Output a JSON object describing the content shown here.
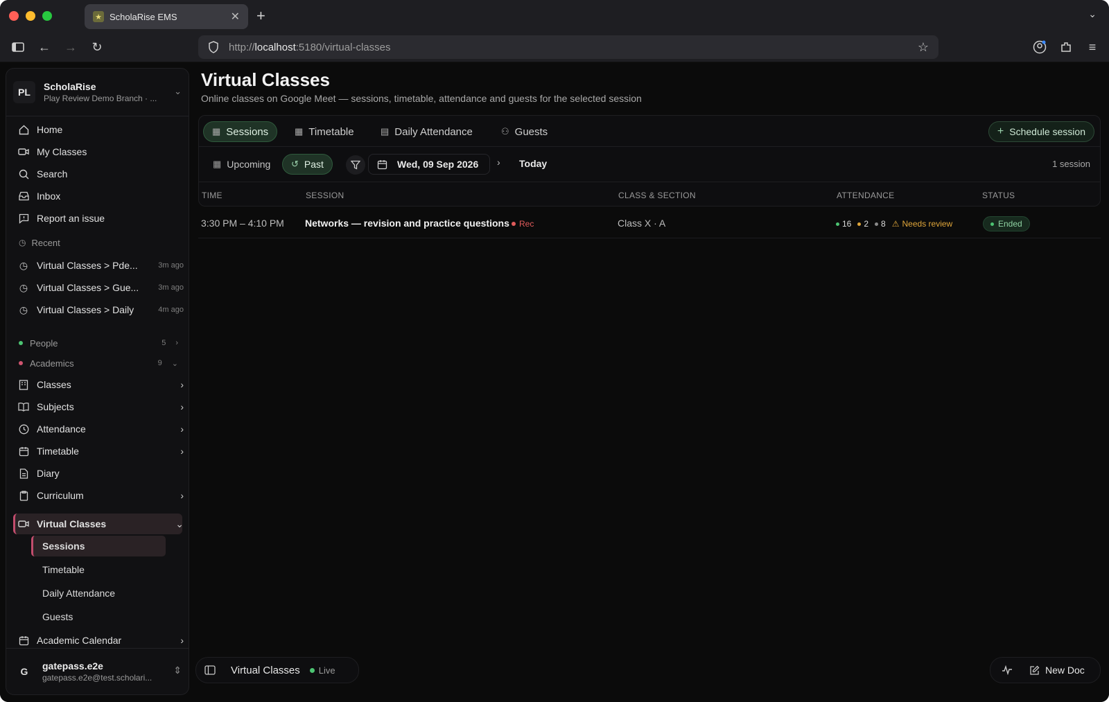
{
  "browser": {
    "tab_title": "ScholaRise EMS",
    "url_prefix": "http://",
    "url_host": "localhost",
    "url_path": ":5180/virtual-classes"
  },
  "workspace": {
    "initials": "PL",
    "name": "ScholaRise",
    "branch": "Play Review Demo Branch · ..."
  },
  "sidebar": {
    "top_items": [
      {
        "label": "Home",
        "icon": "home-icon"
      },
      {
        "label": "My Classes",
        "icon": "video-icon"
      },
      {
        "label": "Search",
        "icon": "search-icon"
      },
      {
        "label": "Inbox",
        "icon": "inbox-icon"
      },
      {
        "label": "Report an issue",
        "icon": "message-icon"
      }
    ],
    "recent_label": "Recent",
    "recent": [
      {
        "label": "Virtual Classes > Pde...",
        "time": "3m ago"
      },
      {
        "label": "Virtual Classes > Gue...",
        "time": "3m ago"
      },
      {
        "label": "Virtual Classes > Daily",
        "time": "4m ago"
      }
    ],
    "groups": [
      {
        "label": "People",
        "count": "5",
        "color": "#4cc472"
      },
      {
        "label": "Academics",
        "count": "9",
        "color": "#d0546f"
      }
    ],
    "academic_items": [
      {
        "label": "Classes",
        "icon": "building-icon"
      },
      {
        "label": "Subjects",
        "icon": "book-icon"
      },
      {
        "label": "Attendance",
        "icon": "clock-icon"
      },
      {
        "label": "Timetable",
        "icon": "calendar-icon"
      },
      {
        "label": "Diary",
        "icon": "file-icon"
      },
      {
        "label": "Curriculum",
        "icon": "clipboard-icon"
      },
      {
        "label": "Virtual Classes",
        "icon": "video-icon"
      }
    ],
    "sub_items": [
      "Sessions",
      "Timetable",
      "Daily Attendance",
      "Guests"
    ],
    "calendar_item": "Academic Calendar"
  },
  "user": {
    "initial": "G",
    "name": "gatepass.e2e",
    "email": "gatepass.e2e@test.scholari..."
  },
  "page": {
    "title": "Virtual Classes",
    "subtitle": "Online classes on Google Meet — sessions, timetable, attendance and guests for the selected session"
  },
  "tabs": [
    {
      "label": "Sessions",
      "icon": "calendar-icon",
      "active": true
    },
    {
      "label": "Timetable",
      "icon": "grid-calendar-icon",
      "active": false
    },
    {
      "label": "Daily Attendance",
      "icon": "clipboard-icon",
      "active": false
    },
    {
      "label": "Guests",
      "icon": "users-icon",
      "active": false
    }
  ],
  "schedule_button": "Schedule session",
  "filters": {
    "upcoming": "Upcoming",
    "past": "Past",
    "date": "Wed, 09 Sep 2026",
    "today": "Today",
    "count": "1 session"
  },
  "table": {
    "headers": [
      "TIME",
      "SESSION",
      "CLASS & SECTION",
      "ATTENDANCE",
      "STATUS"
    ],
    "rows": [
      {
        "time": "3:30 PM – 4:10 PM",
        "session": "Networks — revision and practice questions",
        "rec": "Rec",
        "class_section": "Class X · A",
        "present": "16",
        "late": "2",
        "absent": "8",
        "review": "Needs review",
        "status": "Ended"
      }
    ]
  },
  "bottom": {
    "title": "Virtual Classes",
    "live": "Live",
    "new_doc": "New Doc"
  },
  "colors": {
    "accent_green": "#4cc472",
    "accent_pink": "#c24d6d",
    "warning": "#e0a63a",
    "rec_red": "#e05b5b"
  }
}
